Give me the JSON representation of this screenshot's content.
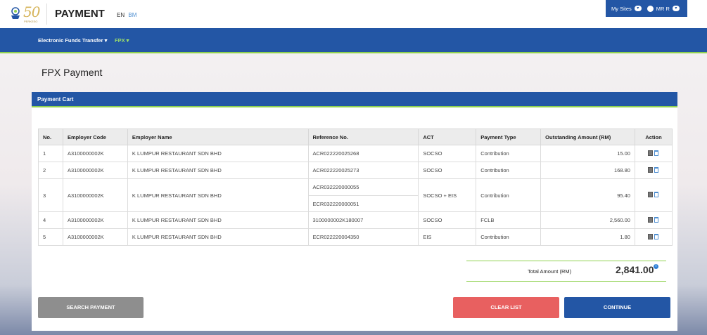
{
  "header": {
    "logo_sub": "PERKESO",
    "logo_number": "50",
    "title": "PAYMENT",
    "lang_en": "EN",
    "lang_bm": "BM",
    "my_sites": "My Sites",
    "user": "MR R"
  },
  "nav": {
    "item1": "Electronic Funds Transfer ▾",
    "item2": "FPX ▾"
  },
  "page": {
    "title": "FPX Payment"
  },
  "panel": {
    "title": "Payment Cart"
  },
  "table": {
    "headers": {
      "no": "No.",
      "employer_code": "Employer Code",
      "employer_name": "Employer Name",
      "reference": "Reference No.",
      "act": "ACT",
      "payment_type": "Payment Type",
      "outstanding": "Outstanding Amount (RM)",
      "action": "Action"
    },
    "rows": [
      {
        "no": "1",
        "code": "A3100000002K",
        "name": "K LUMPUR RESTAURANT SDN BHD",
        "ref": "ACR022220025268",
        "act": "SOCSO",
        "type": "Contribution",
        "amount": "15.00"
      },
      {
        "no": "2",
        "code": "A3100000002K",
        "name": "K LUMPUR RESTAURANT SDN BHD",
        "ref": "ACR022220025273",
        "act": "SOCSO",
        "type": "Contribution",
        "amount": "168.80"
      },
      {
        "no": "3",
        "code": "A3100000002K",
        "name": "K LUMPUR RESTAURANT SDN BHD",
        "ref": "ACR032220000055",
        "ref2": "ECR032220000051",
        "act": "SOCSO + EIS",
        "type": "Contribution",
        "amount": "95.40"
      },
      {
        "no": "4",
        "code": "A3100000002K",
        "name": "K LUMPUR RESTAURANT SDN BHD",
        "ref": "3100000002K180007",
        "act": "SOCSO",
        "type": "FCLB",
        "amount": "2,560.00"
      },
      {
        "no": "5",
        "code": "A3100000002K",
        "name": "K LUMPUR RESTAURANT SDN BHD",
        "ref": "ECR022220004350",
        "act": "EIS",
        "type": "Contribution",
        "amount": "1.80"
      }
    ]
  },
  "total": {
    "label": "Total Amount (RM)",
    "value": "2,841.00"
  },
  "buttons": {
    "search": "SEARCH PAYMENT",
    "clear": "CLEAR LIST",
    "continue": "CONTINUE"
  },
  "colors": {
    "brand_blue": "#2356a5",
    "accent_green": "#8fd14f",
    "clear_red": "#e86060",
    "search_gray": "#8e8e8e"
  }
}
